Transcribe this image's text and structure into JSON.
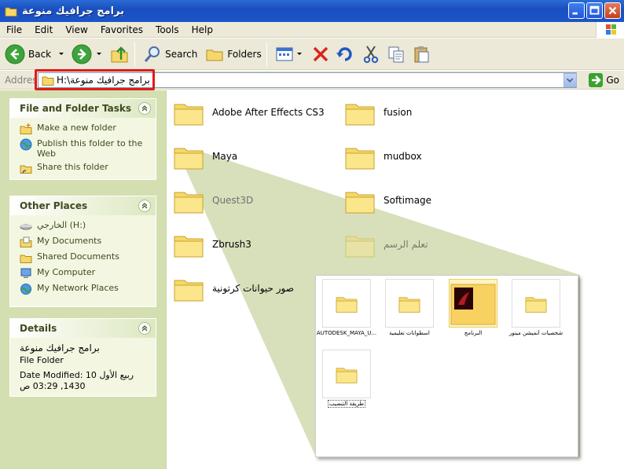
{
  "window": {
    "title": "برامج جرافيك منوعة"
  },
  "menu": [
    "File",
    "Edit",
    "View",
    "Favorites",
    "Tools",
    "Help"
  ],
  "toolbar": {
    "back": "Back",
    "search": "Search",
    "folders": "Folders"
  },
  "address": {
    "label": "Address",
    "value": "H:\\برامج جرافيك منوعة",
    "go": "Go"
  },
  "tasks": {
    "title": "File and Folder Tasks",
    "items": [
      "Make a new folder",
      "Publish this folder to the Web",
      "Share this folder"
    ]
  },
  "places": {
    "title": "Other Places",
    "items": [
      "الخارجي (H:)",
      "My Documents",
      "Shared Documents",
      "My Computer",
      "My Network Places"
    ]
  },
  "details": {
    "title": "Details",
    "name": "برامج جرافيك منوعة",
    "type": "File Folder",
    "modified": "Date Modified: 10 ربيع الأول 1430, 03:29 ص"
  },
  "folders": [
    "Adobe After Effects CS3",
    "fusion",
    "Maya",
    "mudbox",
    "Quest3D",
    "Softimage",
    "Zbrush3",
    "تعلم الرسم",
    "صور حيوانات كرتونية"
  ],
  "zoom": {
    "items": [
      "AUTODESK_MAYA_U...",
      "اسطوانات تعليمية",
      "البرنامج",
      "شخصيات أنميشن ميتور",
      "طريقة التنصيب"
    ]
  }
}
